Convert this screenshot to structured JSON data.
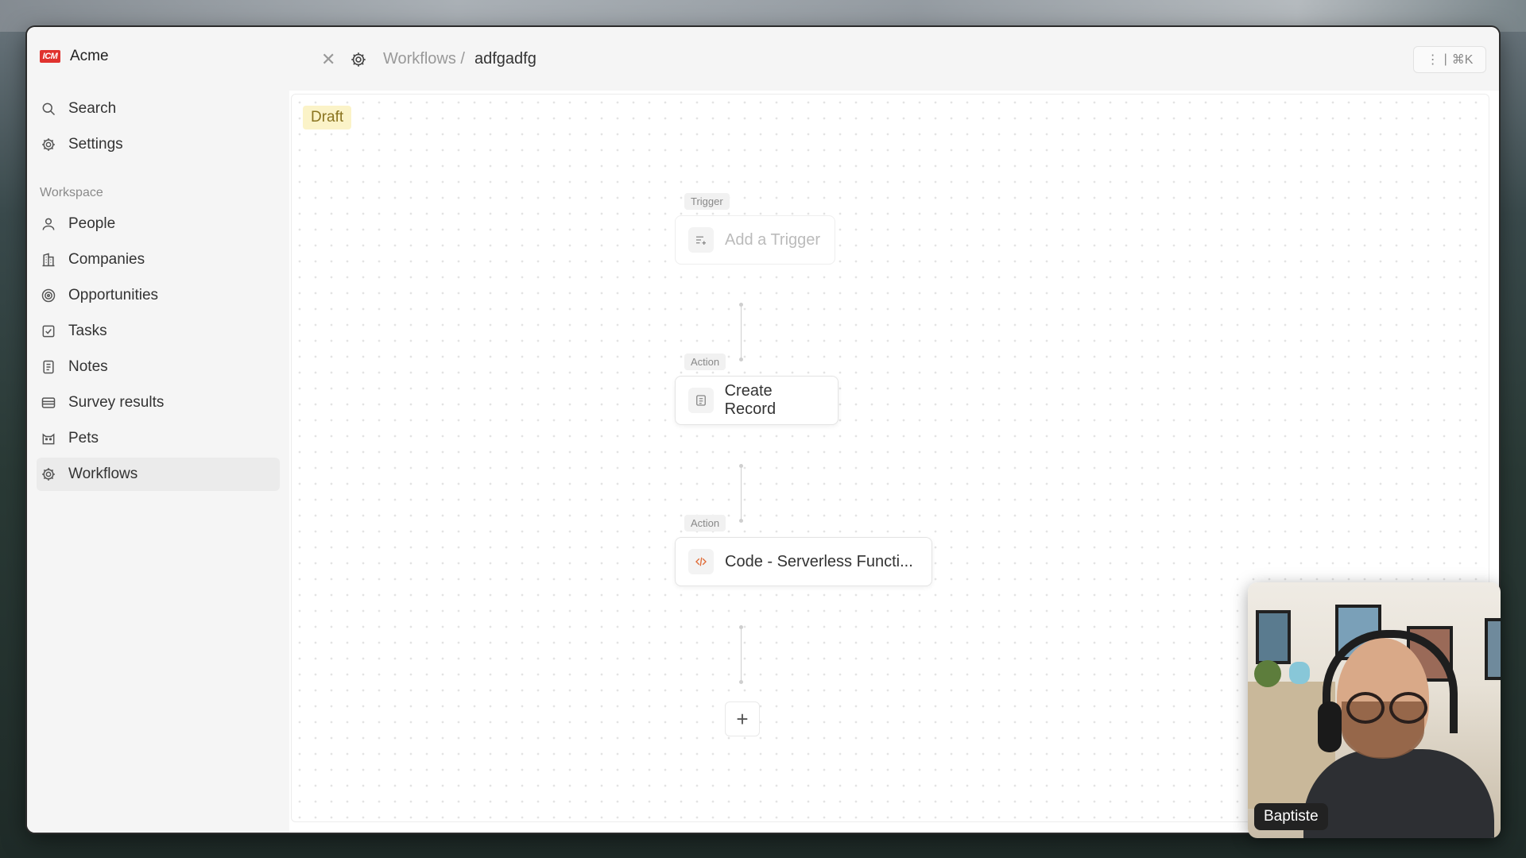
{
  "sidebar": {
    "brand": {
      "logo_text": "ICM",
      "name": "Acme"
    },
    "top_items": [
      {
        "label": "Search",
        "icon": "search-icon"
      },
      {
        "label": "Settings",
        "icon": "gear-icon"
      }
    ],
    "section_label": "Workspace",
    "items": [
      {
        "label": "People",
        "icon": "user-icon"
      },
      {
        "label": "Companies",
        "icon": "building-icon"
      },
      {
        "label": "Opportunities",
        "icon": "target-icon"
      },
      {
        "label": "Tasks",
        "icon": "checkbox-icon"
      },
      {
        "label": "Notes",
        "icon": "note-icon"
      },
      {
        "label": "Survey results",
        "icon": "table-icon"
      },
      {
        "label": "Pets",
        "icon": "cat-icon"
      },
      {
        "label": "Workflows",
        "icon": "gear-icon",
        "active": true
      }
    ]
  },
  "topbar": {
    "breadcrumb_parent": "Workflows /",
    "breadcrumb_current": "adfgadfg",
    "shortcut_label": "⌘K"
  },
  "canvas": {
    "status_badge": "Draft",
    "nodes": [
      {
        "type_label": "Trigger",
        "title": "Add a Trigger",
        "icon": "list-add-icon"
      },
      {
        "type_label": "Action",
        "title": "Create Record",
        "icon": "record-icon"
      },
      {
        "type_label": "Action",
        "title": "Code - Serverless Functi...",
        "icon": "code-icon"
      }
    ],
    "add_button_label": "+"
  },
  "webcam": {
    "name": "Baptiste"
  },
  "colors": {
    "brand_red": "#e0322e",
    "draft_bg": "#fbf3c8",
    "code_icon_orange": "#e06a35"
  }
}
